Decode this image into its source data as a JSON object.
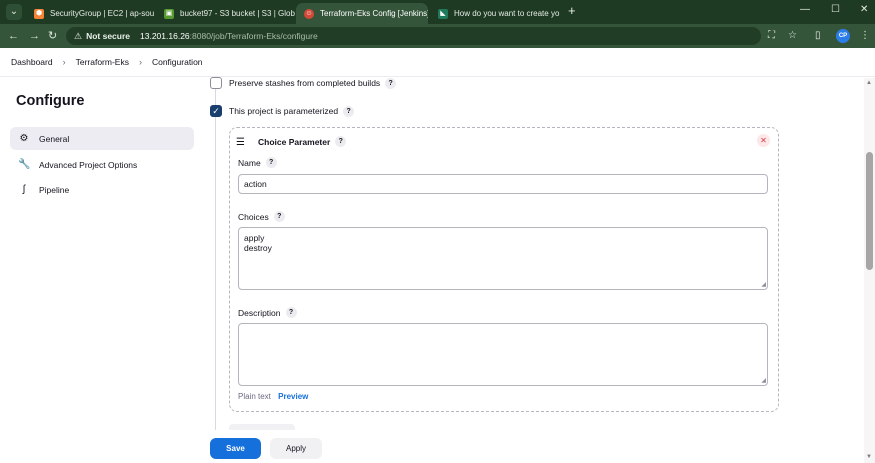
{
  "browser": {
    "tabs": [
      {
        "title": "SecurityGroup | EC2 | ap-south",
        "favicon": "aws-icon",
        "color": "#f58534"
      },
      {
        "title": "bucket97 - S3 bucket | S3 | Glob",
        "favicon": "s3-icon",
        "color": "#569a31"
      },
      {
        "title": "Terraform-Eks Config [Jenkins]",
        "favicon": "jenkins-icon",
        "color": "#d24939"
      },
      {
        "title": "How do you want to create yo",
        "favicon": "eks-icon",
        "color": "#1f7a5c"
      }
    ],
    "new_tab": "+",
    "address": {
      "security_label": "Not secure",
      "host": "13.201.16.26",
      "path": ":8080/job/Terraform-Eks/configure"
    },
    "profile_initials": "CP"
  },
  "breadcrumb": [
    "Dashboard",
    "Terraform-Eks",
    "Configuration"
  ],
  "sidebar": {
    "title": "Configure",
    "items": [
      {
        "label": "General",
        "icon": "gear-icon"
      },
      {
        "label": "Advanced Project Options",
        "icon": "wrench-icon"
      },
      {
        "label": "Pipeline",
        "icon": "pipeline-icon"
      }
    ]
  },
  "main": {
    "preserve_stashes": {
      "label": "Preserve stashes from completed builds",
      "checked": false
    },
    "parameterized": {
      "label": "This project is parameterized",
      "checked": true
    },
    "parameter": {
      "type_label": "Choice Parameter",
      "name_label": "Name",
      "name_value": "action",
      "choices_label": "Choices",
      "choices": [
        "apply",
        "destroy"
      ],
      "description_label": "Description",
      "description_value": "",
      "plain_text": "Plain text",
      "preview": "Preview"
    },
    "help": "?"
  },
  "buttons": {
    "save": "Save",
    "apply": "Apply"
  }
}
